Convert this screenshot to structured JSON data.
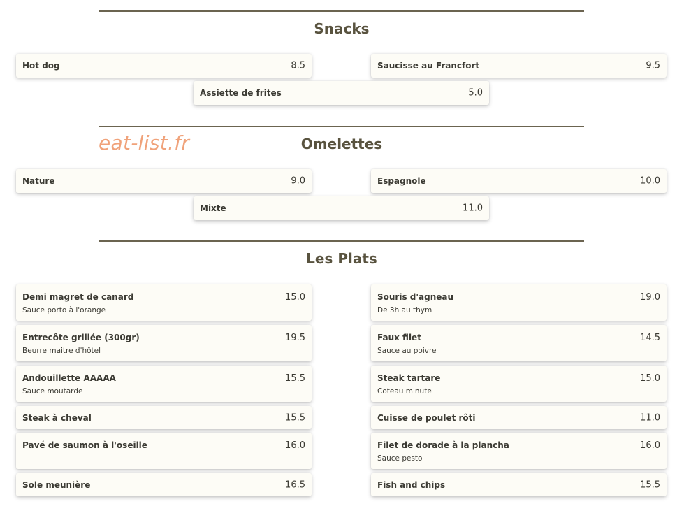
{
  "watermark": "eat-list.fr",
  "sections": {
    "snacks": {
      "title": "Snacks",
      "items": [
        {
          "name": "Hot dog",
          "price": "8.5"
        },
        {
          "name": "Saucisse au Francfort",
          "price": "9.5"
        },
        {
          "name": "Assiette de frites",
          "price": "5.0"
        }
      ]
    },
    "omelettes": {
      "title": "Omelettes",
      "items": [
        {
          "name": "Nature",
          "price": "9.0"
        },
        {
          "name": "Espagnole",
          "price": "10.0"
        },
        {
          "name": "Mixte",
          "price": "11.0"
        }
      ]
    },
    "plats": {
      "title": "Les Plats",
      "items": [
        {
          "name": "Demi magret de canard",
          "price": "15.0",
          "desc": "Sauce porto à l'orange"
        },
        {
          "name": "Souris d'agneau",
          "price": "19.0",
          "desc": "De 3h au thym"
        },
        {
          "name": "Entrecôte grillée (300gr)",
          "price": "19.5",
          "desc": "Beurre maitre d'hôtel"
        },
        {
          "name": "Faux filet",
          "price": "14.5",
          "desc": "Sauce au poivre"
        },
        {
          "name": "Andouillette AAAAA",
          "price": "15.5",
          "desc": "Sauce moutarde"
        },
        {
          "name": "Steak tartare",
          "price": "15.0",
          "desc": "Coteau minute"
        },
        {
          "name": "Steak à cheval",
          "price": "15.5"
        },
        {
          "name": "Cuisse de poulet rôti",
          "price": "11.0"
        },
        {
          "name": "Pavé de saumon à l'oseille",
          "price": "16.0"
        },
        {
          "name": "Filet de dorade à la plancha",
          "price": "16.0",
          "desc": "Sauce pesto"
        },
        {
          "name": "Sole meunière",
          "price": "16.5"
        },
        {
          "name": "Fish and chips",
          "price": "15.5"
        }
      ]
    }
  }
}
